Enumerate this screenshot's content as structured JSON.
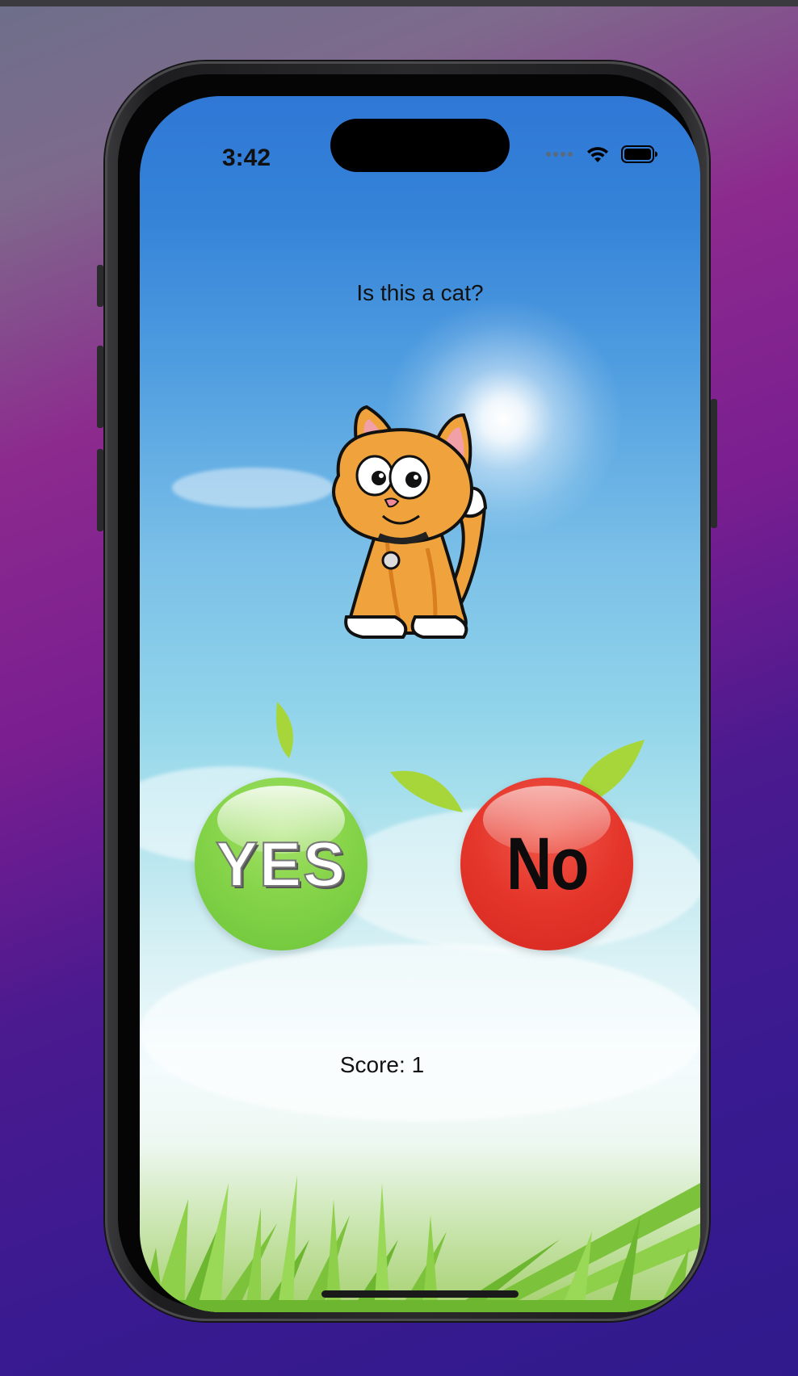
{
  "status_bar": {
    "time": "3:42",
    "icons": [
      "signal-dots-icon",
      "wifi-icon",
      "battery-icon"
    ]
  },
  "quiz": {
    "question": "Is this a cat?",
    "image": "cartoon-cat"
  },
  "buttons": {
    "yes_label": "YES",
    "no_label": "No"
  },
  "score": {
    "text": "Score: 1"
  },
  "colors": {
    "yes_button": "#86d44a",
    "no_button": "#e5362b",
    "sky_top": "#2f78d6"
  }
}
